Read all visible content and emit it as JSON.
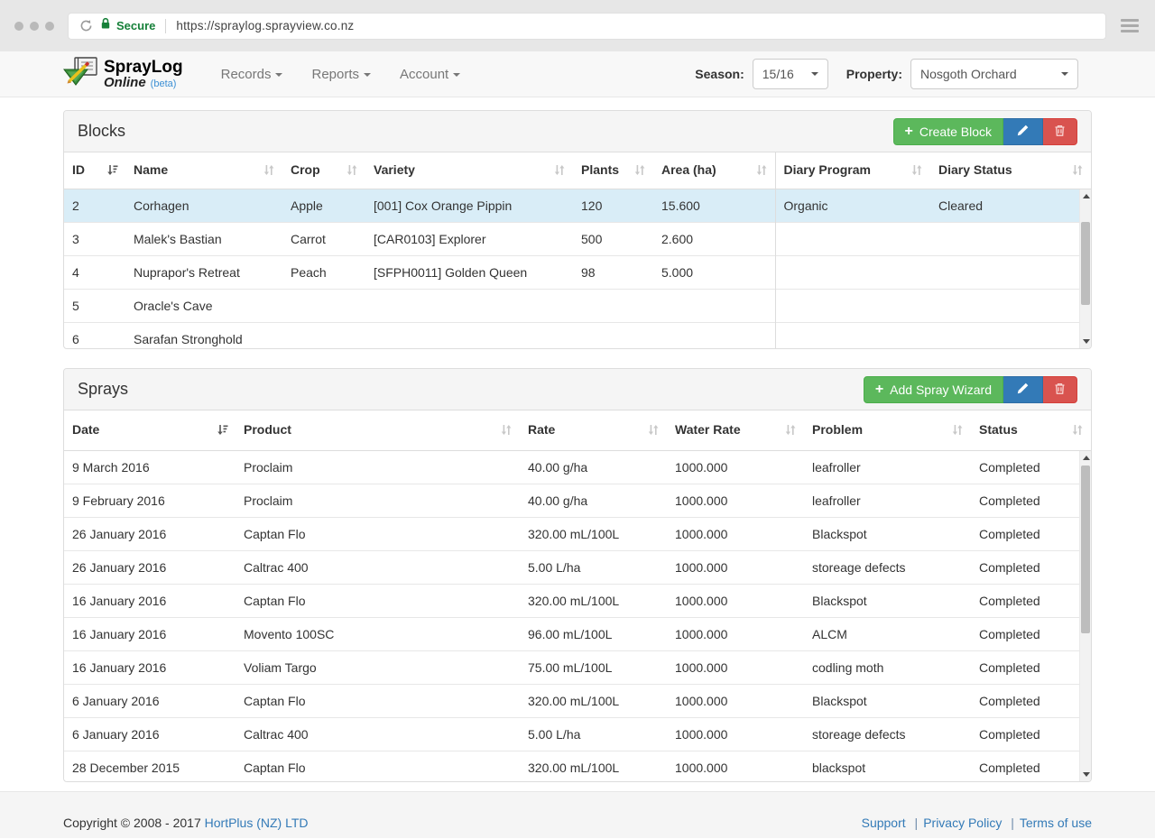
{
  "browser": {
    "url": "https://spraylog.sprayview.co.nz",
    "secure_label": "Secure"
  },
  "navbar": {
    "brand": {
      "name": "SprayLog",
      "sub": "Online",
      "beta": "(beta)"
    },
    "menus": [
      {
        "label": "Records"
      },
      {
        "label": "Reports"
      },
      {
        "label": "Account"
      }
    ],
    "season": {
      "label": "Season:",
      "value": "15/16"
    },
    "property": {
      "label": "Property:",
      "value": "Nosgoth Orchard"
    }
  },
  "blocks_panel": {
    "title": "Blocks",
    "create_button": "Create Block",
    "columns": [
      {
        "label": "ID",
        "sort": "asc"
      },
      {
        "label": "Name",
        "sort": "none"
      },
      {
        "label": "Crop",
        "sort": "none"
      },
      {
        "label": "Variety",
        "sort": "none"
      },
      {
        "label": "Plants",
        "sort": "none"
      },
      {
        "label": "Area (ha)",
        "sort": "none"
      },
      {
        "label": "Diary Program",
        "sort": "none"
      },
      {
        "label": "Diary Status",
        "sort": "none"
      }
    ],
    "rows": [
      {
        "id": "2",
        "name": "Corhagen",
        "crop": "Apple",
        "variety": "[001] Cox Orange Pippin",
        "plants": "120",
        "area": "15.600",
        "diary_program": "Organic",
        "diary_status": "Cleared",
        "selected": true
      },
      {
        "id": "3",
        "name": "Malek's Bastian",
        "crop": "Carrot",
        "variety": "[CAR0103] Explorer",
        "plants": "500",
        "area": "2.600",
        "diary_program": "",
        "diary_status": ""
      },
      {
        "id": "4",
        "name": "Nuprapor's Retreat",
        "crop": "Peach",
        "variety": "[SFPH0011] Golden Queen",
        "plants": "98",
        "area": "5.000",
        "diary_program": "",
        "diary_status": ""
      },
      {
        "id": "5",
        "name": "Oracle's Cave",
        "crop": "",
        "variety": "",
        "plants": "",
        "area": "",
        "diary_program": "",
        "diary_status": ""
      },
      {
        "id": "6",
        "name": "Sarafan Stronghold",
        "crop": "",
        "variety": "",
        "plants": "",
        "area": "",
        "diary_program": "",
        "diary_status": ""
      }
    ]
  },
  "sprays_panel": {
    "title": "Sprays",
    "add_button": "Add Spray Wizard",
    "columns": [
      {
        "label": "Date",
        "sort": "desc"
      },
      {
        "label": "Product",
        "sort": "none"
      },
      {
        "label": "Rate",
        "sort": "none"
      },
      {
        "label": "Water Rate",
        "sort": "none"
      },
      {
        "label": "Problem",
        "sort": "none"
      },
      {
        "label": "Status",
        "sort": "none"
      }
    ],
    "rows": [
      {
        "date": "9 March 2016",
        "product": "Proclaim",
        "rate": "40.00 g/ha",
        "water_rate": "1000.000",
        "problem": "leafroller",
        "status": "Completed"
      },
      {
        "date": "9 February 2016",
        "product": "Proclaim",
        "rate": "40.00 g/ha",
        "water_rate": "1000.000",
        "problem": "leafroller",
        "status": "Completed"
      },
      {
        "date": "26 January 2016",
        "product": "Captan Flo",
        "rate": "320.00 mL/100L",
        "water_rate": "1000.000",
        "problem": "Blackspot",
        "status": "Completed"
      },
      {
        "date": "26 January 2016",
        "product": "Caltrac 400",
        "rate": "5.00 L/ha",
        "water_rate": "1000.000",
        "problem": "storeage defects",
        "status": "Completed"
      },
      {
        "date": "16 January 2016",
        "product": "Captan Flo",
        "rate": "320.00 mL/100L",
        "water_rate": "1000.000",
        "problem": "Blackspot",
        "status": "Completed"
      },
      {
        "date": "16 January 2016",
        "product": "Movento 100SC",
        "rate": "96.00 mL/100L",
        "water_rate": "1000.000",
        "problem": "ALCM",
        "status": "Completed"
      },
      {
        "date": "16 January 2016",
        "product": "Voliam Targo",
        "rate": "75.00 mL/100L",
        "water_rate": "1000.000",
        "problem": "codling moth",
        "status": "Completed"
      },
      {
        "date": "6 January 2016",
        "product": "Captan Flo",
        "rate": "320.00 mL/100L",
        "water_rate": "1000.000",
        "problem": "Blackspot",
        "status": "Completed"
      },
      {
        "date": "6 January 2016",
        "product": "Caltrac 400",
        "rate": "5.00 L/ha",
        "water_rate": "1000.000",
        "problem": "storeage defects",
        "status": "Completed"
      },
      {
        "date": "28 December 2015",
        "product": "Captan Flo",
        "rate": "320.00 mL/100L",
        "water_rate": "1000.000",
        "problem": "blackspot",
        "status": "Completed"
      }
    ]
  },
  "footer": {
    "copyright_prefix": "Copyright © 2008 - 2017 ",
    "company_link": "HortPlus (NZ) LTD",
    "links": [
      {
        "sep": "",
        "label": "Support"
      },
      {
        "sep": "|",
        "label": "Privacy Policy"
      },
      {
        "sep": "|",
        "label": "Terms of use"
      }
    ]
  },
  "icons": {
    "plus": "+",
    "pencil": "svg-pencil",
    "trash": "svg-trash",
    "sort_unsorted": "svg-sort-both-arrows",
    "sort_active": "svg-sort-amount",
    "caret_down": "css-triangle",
    "lock": "svg-lock",
    "refresh": "svg-refresh",
    "hamburger": "css-bars"
  },
  "colors": {
    "accent_green": "#5cb85c",
    "accent_blue": "#337ab7",
    "accent_red": "#d9534f",
    "selected_row": "#d9edf7",
    "link": "#337ab7",
    "secure_green": "#168039"
  }
}
